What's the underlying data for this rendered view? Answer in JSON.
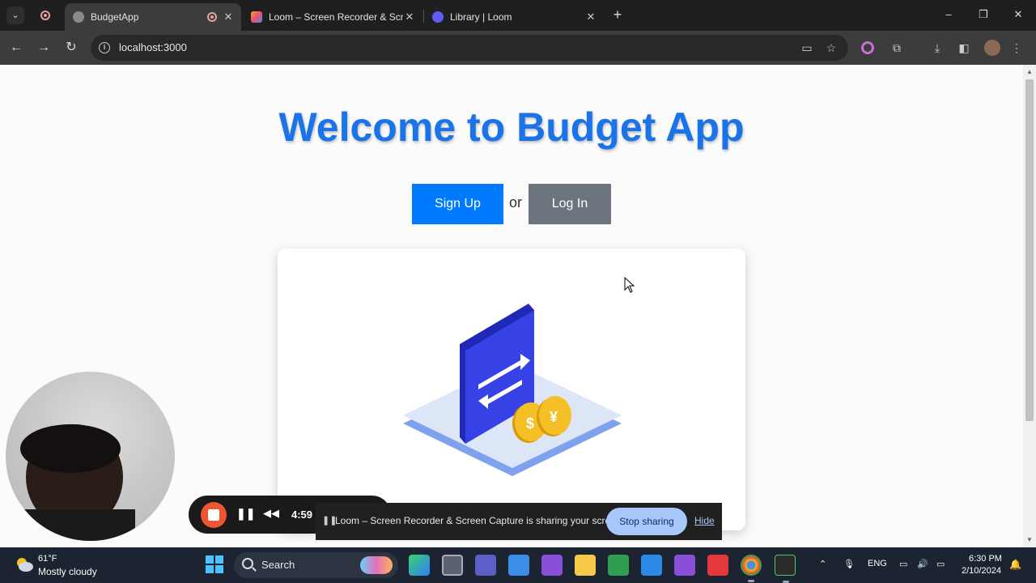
{
  "browser": {
    "tabs": [
      {
        "title": "BudgetApp",
        "active": true
      },
      {
        "title": "Loom – Screen Recorder & Scre",
        "active": false
      },
      {
        "title": "Library | Loom",
        "active": false
      }
    ],
    "new_tab_label": "+",
    "window_controls": {
      "minimize": "–",
      "restore": "❐",
      "close": "✕"
    },
    "address": "localhost:3000"
  },
  "page": {
    "heading": "Welcome to Budget App",
    "signup_label": "Sign Up",
    "or_text": "or",
    "login_label": "Log In"
  },
  "loom": {
    "timer": "4:59",
    "share_message": "Loom – Screen Recorder & Screen Capture is sharing your screen.",
    "stop_sharing_label": "Stop sharing",
    "hide_label": "Hide"
  },
  "taskbar": {
    "weather_temp": "61°F",
    "weather_desc": "Mostly cloudy",
    "search_label": "Search",
    "language": "ENG",
    "time": "6:30 PM",
    "date": "2/10/2024"
  },
  "colors": {
    "heading": "#1a73e8",
    "signup_bg": "#007bff",
    "login_bg": "#6c757d",
    "loom_stop": "#ef5533",
    "stop_sharing_bg": "#a8c7fa"
  }
}
